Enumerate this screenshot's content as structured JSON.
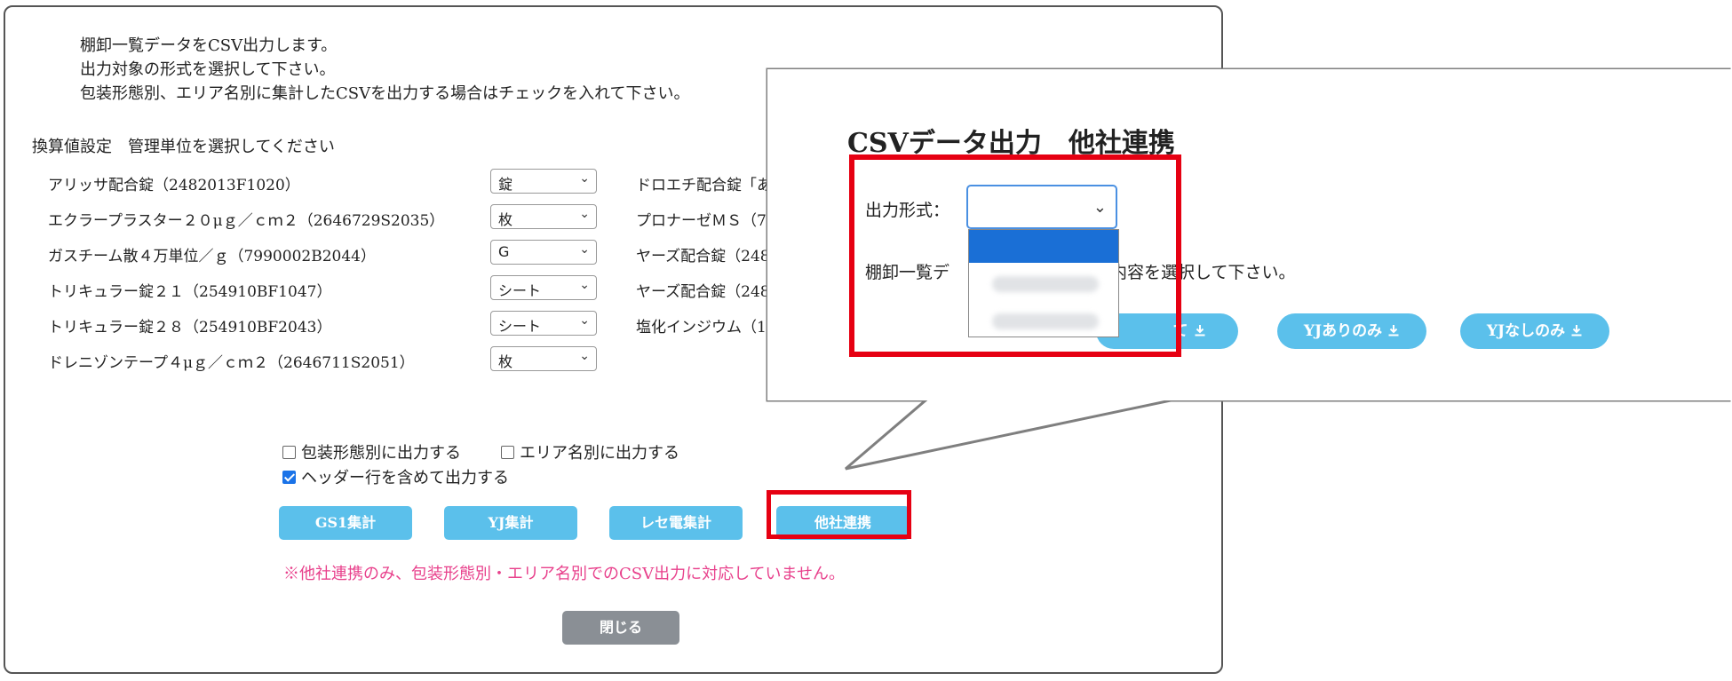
{
  "dialog": {
    "intro": [
      "棚卸一覧データをCSV出力します。",
      "出力対象の形式を選択して下さい。",
      "包装形態別、エリア名別に集計したCSVを出力する場合はチェックを入れて下さい。"
    ],
    "section_title": "換算値設定　管理単位を選択してください",
    "items": [
      {
        "name": "アリッサ配合錠（2482013F1020）",
        "unit": "錠"
      },
      {
        "name": "エクラープラスター２０μｇ／ｃｍ２（2646729S2035）",
        "unit": "枚"
      },
      {
        "name": "ガスチーム散４万単位／ｇ（7990002B2044）",
        "unit": "G"
      },
      {
        "name": "トリキュラー錠２１（254910BF1047）",
        "unit": "シート"
      },
      {
        "name": "トリキュラー錠２８（254910BF2043）",
        "unit": "シート"
      },
      {
        "name": "ドレニゾンテープ４μｇ／ｃｍ２（2646711S2051）",
        "unit": "枚"
      }
    ],
    "right_items": [
      "ドロエチ配合錠「あ",
      "プロナーゼＭＳ（7",
      "ヤーズ配合錠（248",
      "ヤーズ配合錠（248",
      "塩化インジウム（1"
    ],
    "checkboxes": {
      "packaging": {
        "label": "包装形態別に出力する",
        "checked": false
      },
      "area": {
        "label": "エリア名別に出力する",
        "checked": false
      },
      "header": {
        "label": "ヘッダー行を含めて出力する",
        "checked": true
      }
    },
    "buttons": {
      "gs1": "GS1集計",
      "yj": "YJ集計",
      "rece": "レセ電集計",
      "partner": "他社連携",
      "close": "閉じる"
    },
    "note": "※他社連携のみ、包装形態別・エリア名別でのCSV出力に対応していません。"
  },
  "callout": {
    "title": "CSVデータ出力　他社連携",
    "format_label": "出力形式：",
    "text_left": "棚卸一覧デ",
    "text_right": "。出力内容を選択して下さい。",
    "btn_all_tail": "て",
    "btn_yj_yes": "YJありのみ",
    "btn_yj_no": "YJなしのみ"
  },
  "colors": {
    "button": "#5bc0eb",
    "highlight": "#e60012",
    "note": "#e8418c",
    "close": "#8a8f95"
  }
}
